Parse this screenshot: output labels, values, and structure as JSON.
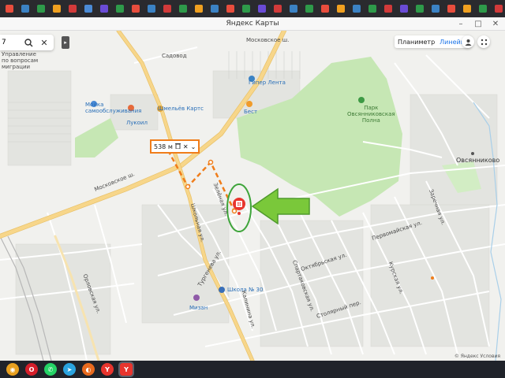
{
  "browser": {
    "tabs": [
      {
        "color": "#e84d3d"
      },
      {
        "color": "#3b82c4"
      },
      {
        "color": "#2e9a4a"
      },
      {
        "color": "#f0a020"
      },
      {
        "color": "#d23a3a"
      },
      {
        "color": "#4b8bd6"
      },
      {
        "color": "#6a4bd6"
      },
      {
        "color": "#2e9a4a"
      },
      {
        "color": "#e84d3d"
      },
      {
        "color": "#3b82c4"
      },
      {
        "color": "#d23a3a"
      },
      {
        "color": "#2e9a4a"
      },
      {
        "color": "#f0a020"
      },
      {
        "color": "#3b82c4"
      },
      {
        "color": "#e84d3d"
      },
      {
        "color": "#2e9a4a"
      },
      {
        "color": "#6a4bd6"
      },
      {
        "color": "#d23a3a"
      },
      {
        "color": "#3b82c4"
      },
      {
        "color": "#2e9a4a"
      },
      {
        "color": "#e84d3d"
      },
      {
        "color": "#f0a020"
      },
      {
        "color": "#3b82c4"
      },
      {
        "color": "#2e9a4a"
      },
      {
        "color": "#d23a3a"
      },
      {
        "color": "#6a4bd6"
      },
      {
        "color": "#2e9a4a"
      },
      {
        "color": "#3b82c4"
      },
      {
        "color": "#e84d3d"
      },
      {
        "color": "#f0a020"
      },
      {
        "color": "#2e9a4a"
      },
      {
        "color": "#d23a3a"
      },
      {
        "color": "#3b82c4"
      },
      {
        "color": "#e84d3d"
      },
      {
        "color": "#6a4bd6"
      },
      {
        "color": "#2e9a4a"
      }
    ],
    "window_title": "Яндекс Карты"
  },
  "search": {
    "value": "7",
    "search_icon": "search-icon",
    "clear_icon": "close-icon",
    "collapse_icon": "chevron-right-icon"
  },
  "layers": {
    "items": [
      {
        "label": "Планиметр",
        "active": false
      },
      {
        "label": "Линейка",
        "active": true
      }
    ]
  },
  "controls": {
    "profile_icon": "user-icon",
    "menu_icon": "apps-icon"
  },
  "ruler": {
    "distance": "538 м",
    "delete_icon": "trash-icon",
    "close_icon": "close-icon",
    "more_icon": "chevron-down-icon"
  },
  "map": {
    "labels": {
      "migration": "Управление\nпо вопросам\nмиграции",
      "moskovskoe_top": "Московское ш.",
      "sadovod": "Садовод",
      "gipper_lenta": "Гипер Лента",
      "best": "Бест",
      "shmelev_karts": "Шмельёв Картс",
      "lukoil": "Лукоил",
      "selfservice": "Мойка\nсамообслуживания",
      "park": "Парк\nОвсянниковская\nПолна",
      "ovsyannikovo": "Овсянниково",
      "moskovskoe_left": "Московское ш.",
      "school": "Школа № 30",
      "mizan": "Мизан",
      "zelenaya": "Зелёная ул.",
      "turgenev": "Тургенева ул.",
      "shkolnaya": "Школьная ул.",
      "kalinin": "Калинина ул.",
      "spartak": "Спартаковская ул.",
      "oktyabr": "Октябрьская ул.",
      "pervomai": "Первомайская ул.",
      "stolyarny": "Столярный пер.",
      "kurskaya": "Курская ул.",
      "zarechnaya": "Заречная ул.",
      "orlovskaya": "Орловская ул."
    },
    "attribution": "© Яндекс  Условия"
  },
  "colors": {
    "ruler": "#f07d1a",
    "pin": "#e8352e",
    "annotation_ring": "#3ea43a",
    "annotation_arrow": "#7ac83a",
    "park": "#c6e7b4",
    "road_major": "#f7d68a"
  },
  "taskbar": {
    "apps": [
      {
        "name": "chrome",
        "color": "#e8a020",
        "glyph": "◉",
        "active": false
      },
      {
        "name": "opera",
        "color": "#d41e2a",
        "glyph": "O",
        "active": false
      },
      {
        "name": "whatsapp",
        "color": "#25d366",
        "glyph": "✆",
        "active": false
      },
      {
        "name": "telegram",
        "color": "#2aa3df",
        "glyph": "➤",
        "active": false
      },
      {
        "name": "firefox",
        "color": "#e86a1e",
        "glyph": "◐",
        "active": false
      },
      {
        "name": "yandex-browser",
        "color": "#e8352e",
        "glyph": "Y",
        "active": false
      },
      {
        "name": "yandex-browser-active",
        "color": "#e8352e",
        "glyph": "Y",
        "active": true
      }
    ]
  }
}
